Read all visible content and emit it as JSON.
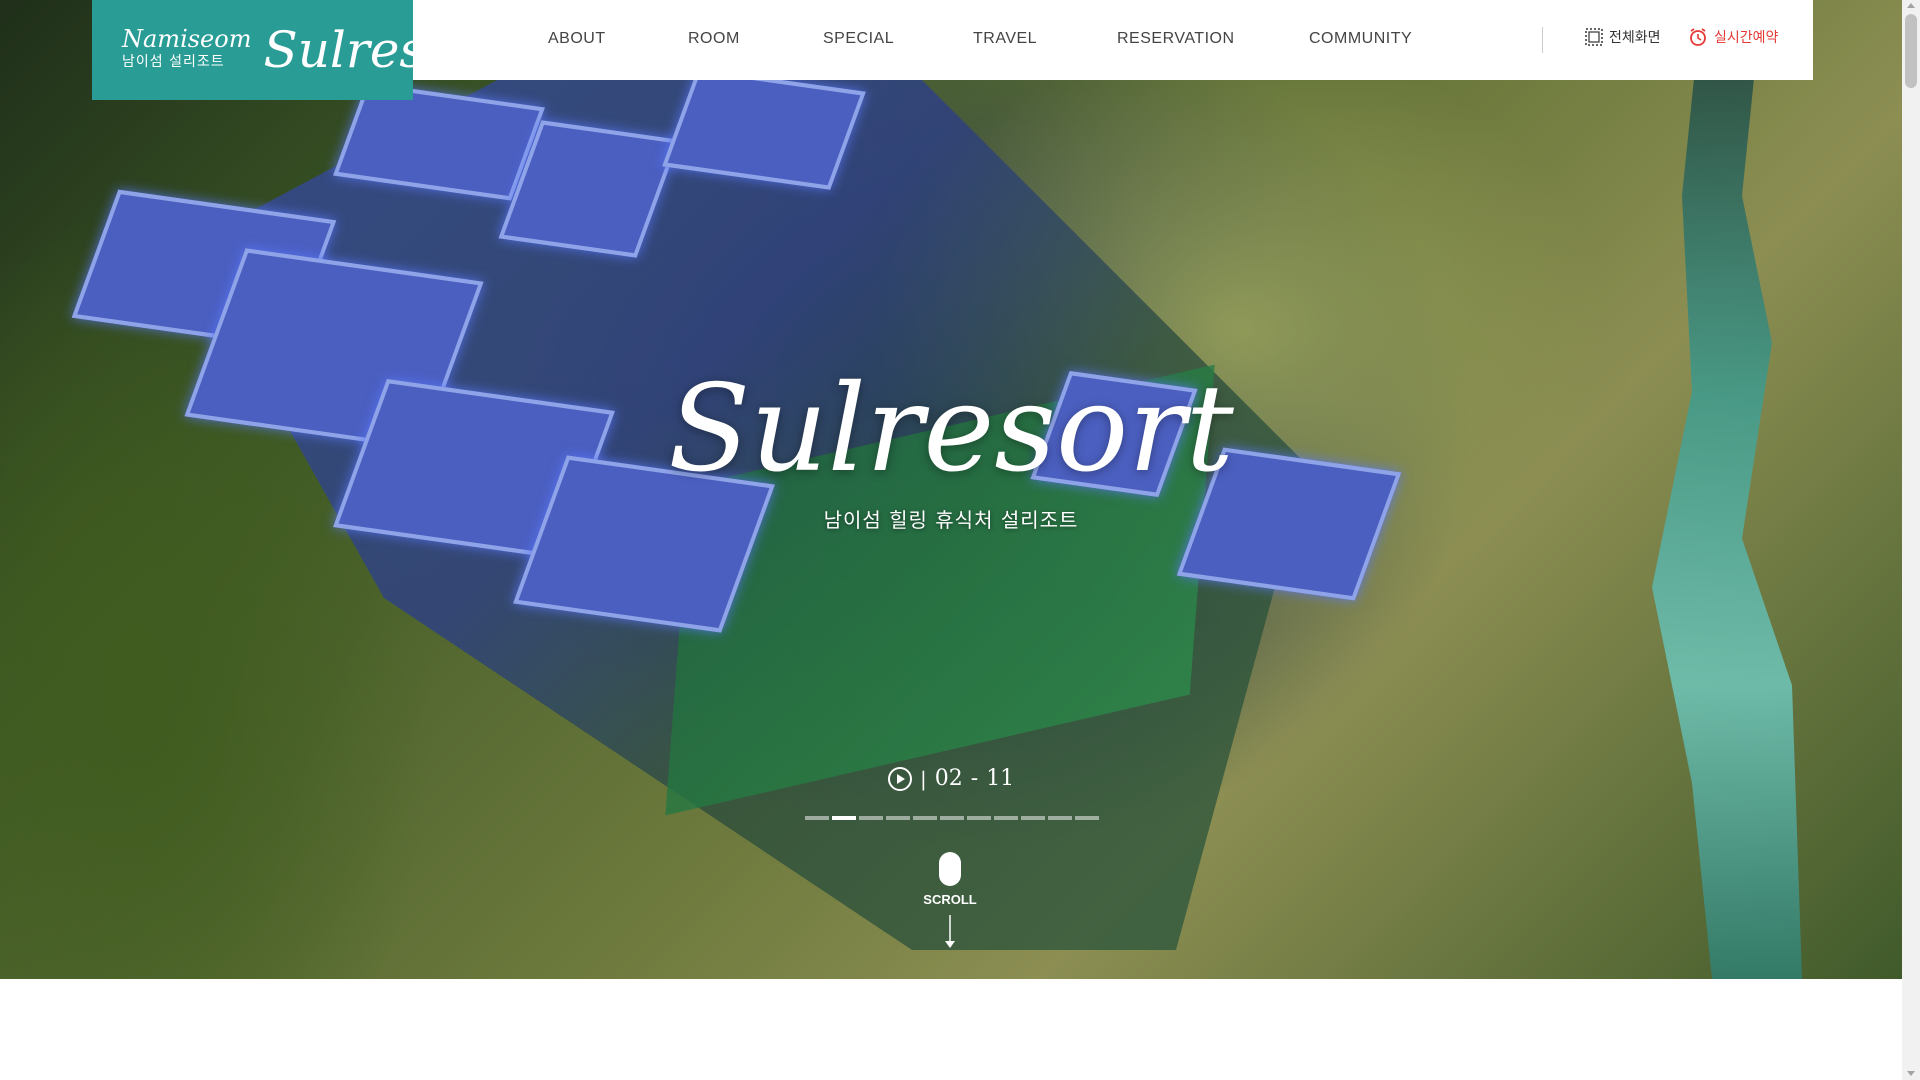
{
  "logo": {
    "brand_small": "Namiseom",
    "brand_korean": "남이섬 설리조트",
    "brand_big": "Sulresort"
  },
  "nav": {
    "items": [
      {
        "label": "ABOUT"
      },
      {
        "label": "ROOM"
      },
      {
        "label": "SPECIAL"
      },
      {
        "label": "TRAVEL"
      },
      {
        "label": "RESERVATION"
      },
      {
        "label": "COMMUNITY"
      }
    ]
  },
  "utility": {
    "fullscreen_label": "전체화면",
    "reservation_label": "실시간예약",
    "fullscreen_icon": "fullscreen-icon",
    "reservation_icon": "alarm-clock-icon"
  },
  "hero": {
    "title": "Sulresort",
    "subtitle": "남이섬 힐링 휴식처 설리조트"
  },
  "slider": {
    "current": "02",
    "separator": "-",
    "total": "11",
    "count": 11,
    "active_index": 1
  },
  "scroll": {
    "label": "SCROLL"
  },
  "colors": {
    "brand": "#2a9c96",
    "reservation_red": "#e53935"
  }
}
